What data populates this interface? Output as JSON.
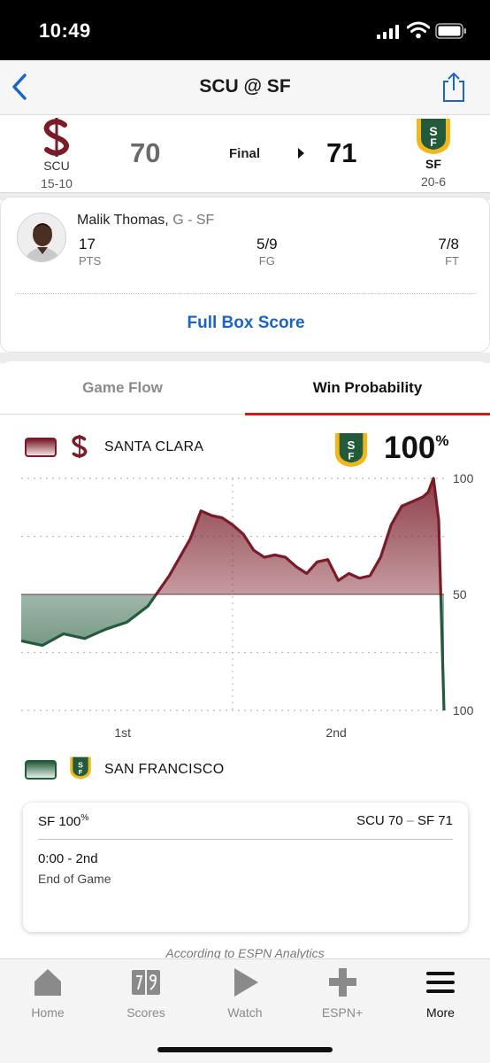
{
  "status_bar": {
    "time": "10:49"
  },
  "nav": {
    "title": "SCU @ SF"
  },
  "game": {
    "away": {
      "abbr": "SCU",
      "record": "15-10",
      "score": "70",
      "name": "SANTA CLARA",
      "color": "#7a1c28"
    },
    "home": {
      "abbr": "SF",
      "record": "20-6",
      "score": "71",
      "name": "SAN FRANCISCO",
      "color": "#245a3c",
      "accent": "#f2b81b"
    },
    "status": "Final"
  },
  "player": {
    "name": "Malik Thomas,",
    "position": "G - SF",
    "stats": [
      {
        "value": "17",
        "label": "PTS"
      },
      {
        "value": "5/9",
        "label": "FG"
      },
      {
        "value": "7/8",
        "label": "FT"
      }
    ]
  },
  "box_score_link": "Full Box Score",
  "tabs": {
    "flow": "Game Flow",
    "win_prob": "Win Probability",
    "active": "win_prob"
  },
  "win_probability": {
    "leader_pct": "100",
    "pct_symbol": "%",
    "y_labels": [
      "100",
      "50",
      "100"
    ],
    "x_labels": [
      "1st",
      "2nd"
    ]
  },
  "chart_data": {
    "type": "area",
    "title": "",
    "xlabel": "",
    "ylabel": "",
    "categories_periods": [
      "1st",
      "2nd"
    ],
    "x": [
      0,
      2,
      4,
      6,
      8,
      10,
      12,
      14,
      16,
      17,
      18,
      19,
      20,
      21,
      22,
      23,
      24,
      25,
      26,
      27,
      28,
      29,
      30,
      31,
      32,
      33,
      34,
      35,
      36,
      37,
      38,
      38.5,
      39,
      39.5,
      40
    ],
    "series": [
      {
        "values": [
          30,
          28,
          33,
          31,
          35,
          38,
          45,
          58,
          74,
          86,
          84,
          83,
          80,
          76,
          69,
          66,
          67,
          66,
          62,
          59,
          64,
          65,
          56,
          59,
          57,
          58,
          66,
          80,
          88,
          90,
          92,
          94,
          100,
          82,
          0
        ]
      }
    ],
    "ylim": [
      0,
      100
    ],
    "midline": 50,
    "grid": true,
    "colors": {
      "scu": "#7a1c28",
      "sf": "#245a3c"
    }
  },
  "play": {
    "leader": "SF 100",
    "leader_sym": "%",
    "away_score": "SCU 70",
    "sep": "–",
    "home_score": "SF 71",
    "clock": "0:00 - 2nd",
    "description": "End of Game"
  },
  "credit": "According to ESPN Analytics",
  "tab_bar": [
    {
      "label": "Home",
      "icon": "home-icon"
    },
    {
      "label": "Scores",
      "icon": "scores-icon"
    },
    {
      "label": "Watch",
      "icon": "play-icon"
    },
    {
      "label": "ESPN+",
      "icon": "plus-icon"
    },
    {
      "label": "More",
      "icon": "menu-icon"
    }
  ]
}
